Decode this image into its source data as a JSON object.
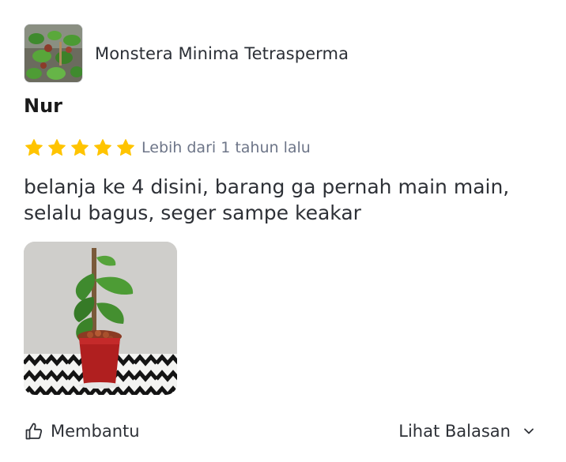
{
  "product": {
    "name": "Monstera Minima Tetrasperma",
    "thumbnail_icon": "plant-thumbnail"
  },
  "review": {
    "reviewer_name": "Nur",
    "rating": 5,
    "rating_max": 5,
    "time_ago": "Lebih dari 1 tahun lalu",
    "text": "belanja ke 4 disini, barang ga pernah main main, selalu bagus, seger sampe keakar",
    "photo_icon": "review-photo-plant"
  },
  "actions": {
    "helpful_label": "Membantu",
    "helpful_icon": "thumbs-up-icon",
    "see_replies_label": "Lihat Balasan",
    "see_replies_icon": "chevron-down-icon"
  },
  "colors": {
    "star": "#FFC400",
    "muted_text": "#6D7588",
    "primary_text": "#2E3137"
  }
}
